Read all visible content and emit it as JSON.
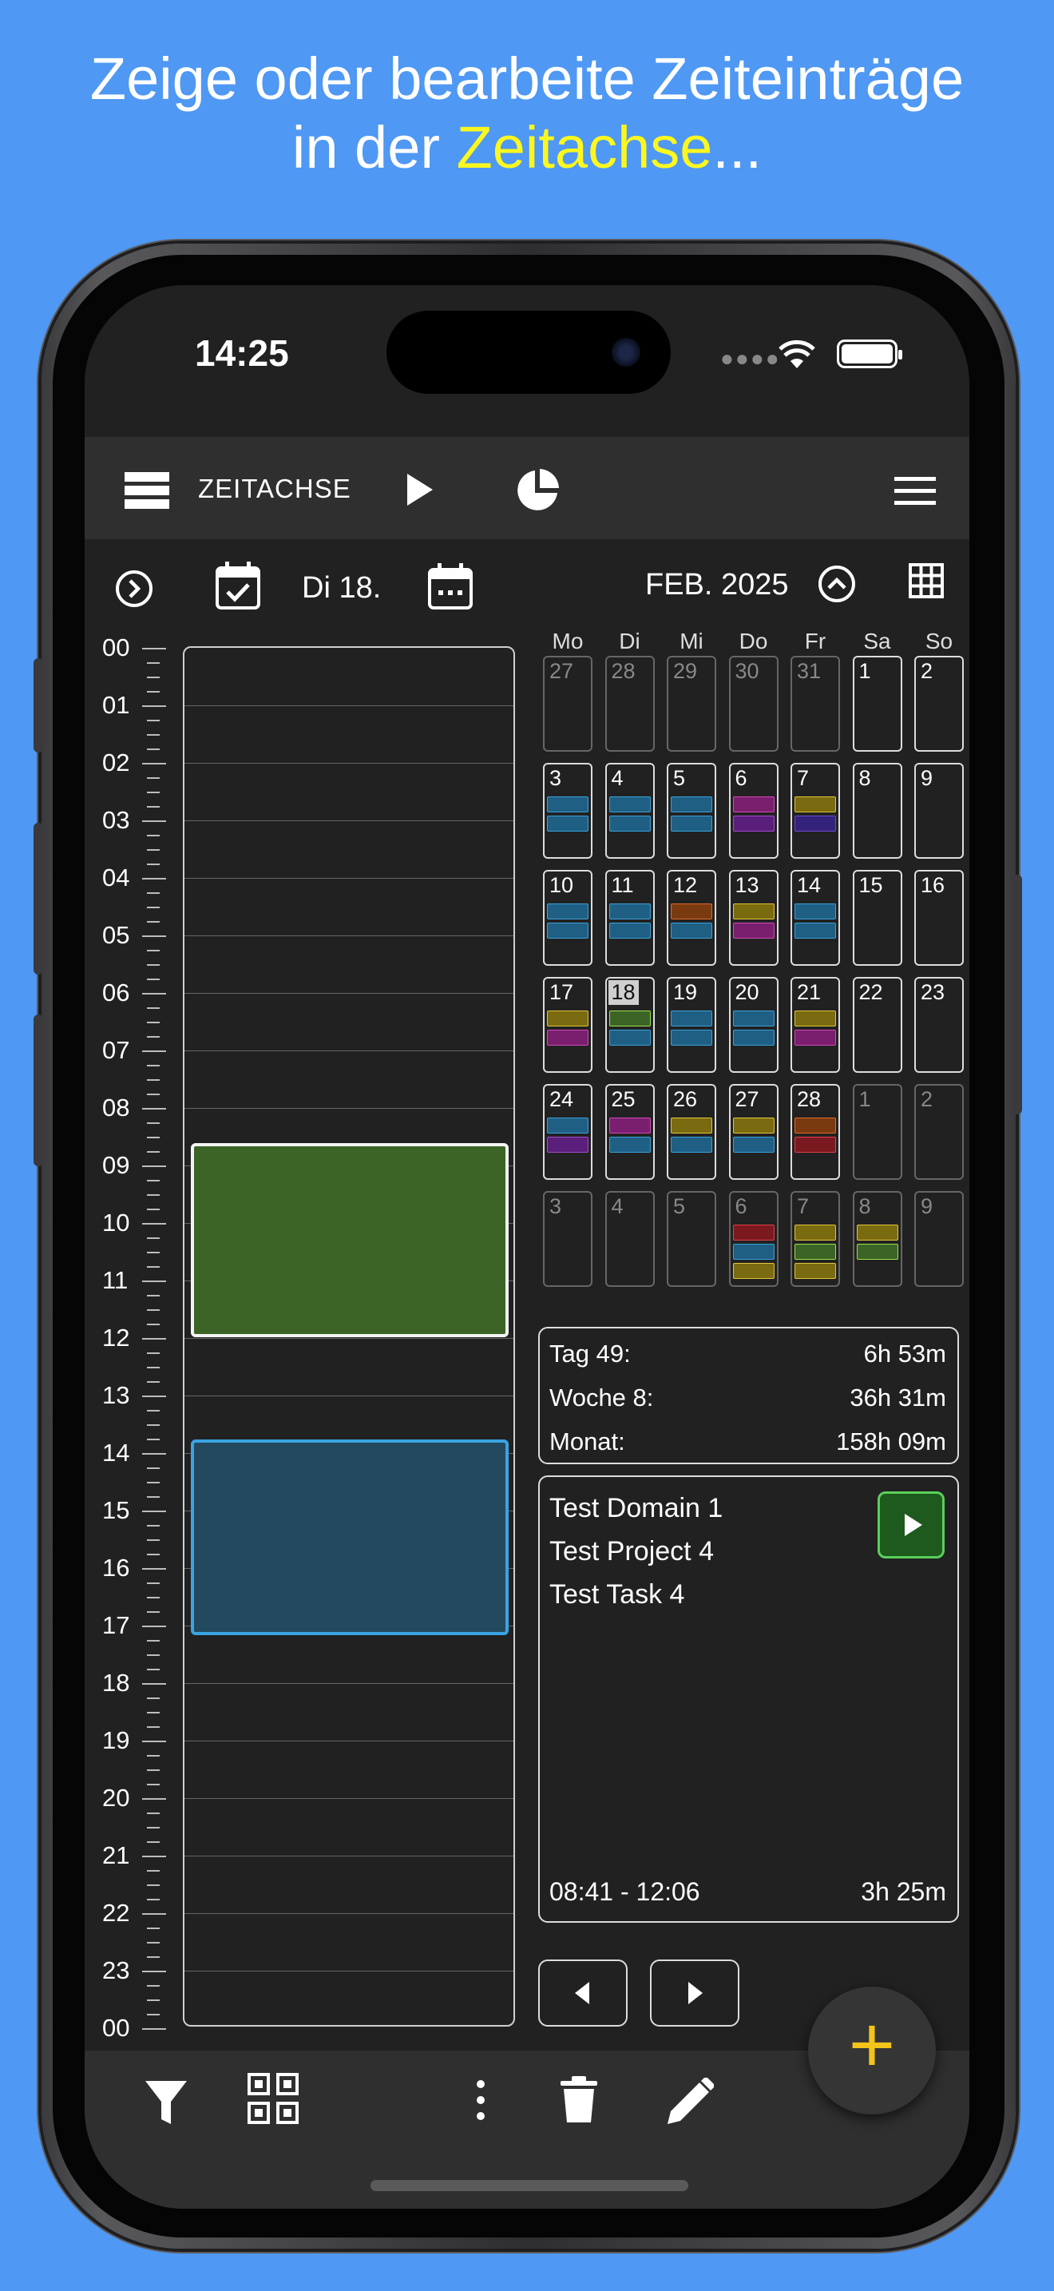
{
  "headline": {
    "line1": "Zeige oder bearbeite Zeiteinträge",
    "line2_prefix": "in der ",
    "line2_highlight": "Zeitachse",
    "line2_suffix": "..."
  },
  "status": {
    "time": "14:25"
  },
  "toolbar": {
    "title": "ZEITACHSE"
  },
  "daterow": {
    "day": "Di 18.",
    "month": "FEB. 2025"
  },
  "hours": [
    "00",
    "01",
    "02",
    "03",
    "04",
    "05",
    "06",
    "07",
    "08",
    "09",
    "10",
    "11",
    "12",
    "13",
    "14",
    "15",
    "16",
    "17",
    "18",
    "19",
    "20",
    "21",
    "22",
    "23",
    "00"
  ],
  "calendar": {
    "weekdays": [
      "Mo",
      "Di",
      "Mi",
      "Do",
      "Fr",
      "Sa",
      "So"
    ],
    "weeks": [
      [
        {
          "d": "27",
          "dim": true
        },
        {
          "d": "28",
          "dim": true
        },
        {
          "d": "29",
          "dim": true
        },
        {
          "d": "30",
          "dim": true
        },
        {
          "d": "31",
          "dim": true
        },
        {
          "d": "1"
        },
        {
          "d": "2"
        }
      ],
      [
        {
          "d": "3",
          "bars": [
            "blue",
            "blue"
          ]
        },
        {
          "d": "4",
          "bars": [
            "blue",
            "blue"
          ]
        },
        {
          "d": "5",
          "bars": [
            "blue",
            "blue"
          ]
        },
        {
          "d": "6",
          "bars": [
            "magenta",
            "purple"
          ]
        },
        {
          "d": "7",
          "bars": [
            "yellow",
            "indigo"
          ]
        },
        {
          "d": "8"
        },
        {
          "d": "9"
        }
      ],
      [
        {
          "d": "10",
          "bars": [
            "blue",
            "blue"
          ]
        },
        {
          "d": "11",
          "bars": [
            "blue",
            "blue"
          ]
        },
        {
          "d": "12",
          "bars": [
            "orange",
            "blue"
          ]
        },
        {
          "d": "13",
          "bars": [
            "yellow",
            "magenta"
          ]
        },
        {
          "d": "14",
          "bars": [
            "blue",
            "blue"
          ]
        },
        {
          "d": "15"
        },
        {
          "d": "16"
        }
      ],
      [
        {
          "d": "17",
          "bars": [
            "yellow",
            "magenta"
          ]
        },
        {
          "d": "18",
          "today": true,
          "bars": [
            "green",
            "blue"
          ]
        },
        {
          "d": "19",
          "bars": [
            "blue",
            "blue"
          ]
        },
        {
          "d": "20",
          "bars": [
            "blue",
            "blue"
          ]
        },
        {
          "d": "21",
          "bars": [
            "yellow",
            "magenta"
          ]
        },
        {
          "d": "22"
        },
        {
          "d": "23"
        }
      ],
      [
        {
          "d": "24",
          "bars": [
            "blue",
            "purple"
          ]
        },
        {
          "d": "25",
          "bars": [
            "magenta",
            "blue"
          ]
        },
        {
          "d": "26",
          "bars": [
            "yellow",
            "blue"
          ]
        },
        {
          "d": "27",
          "bars": [
            "yellow",
            "blue"
          ]
        },
        {
          "d": "28",
          "bars": [
            "orange",
            "red"
          ]
        },
        {
          "d": "1",
          "dim": true
        },
        {
          "d": "2",
          "dim": true
        }
      ],
      [
        {
          "d": "3",
          "dim": true
        },
        {
          "d": "4",
          "dim": true
        },
        {
          "d": "5",
          "dim": true
        },
        {
          "d": "6",
          "dim": true,
          "bars": [
            "red",
            "blue",
            "yellow"
          ]
        },
        {
          "d": "7",
          "dim": true,
          "bars": [
            "yellow",
            "green",
            "yellow"
          ]
        },
        {
          "d": "8",
          "dim": true,
          "bars": [
            "yellow",
            "green"
          ]
        },
        {
          "d": "9",
          "dim": true
        }
      ]
    ]
  },
  "colors": {
    "blue": [
      "#1f5f84",
      "#3aa0d8"
    ],
    "magenta": [
      "#7a1f6e",
      "#d04ab8"
    ],
    "purple": [
      "#5a1f7a",
      "#a44ad0"
    ],
    "yellow": [
      "#7a6a10",
      "#e0c63a"
    ],
    "indigo": [
      "#34237a",
      "#6b4ad0"
    ],
    "orange": [
      "#7a3a10",
      "#e06a2a"
    ],
    "green": [
      "#3b6426",
      "#a0e04a"
    ],
    "red": [
      "#7a1a20",
      "#e0404a"
    ]
  },
  "stats": [
    {
      "label": "Tag 49:",
      "value": "6h 53m"
    },
    {
      "label": "Woche 8:",
      "value": "36h 31m"
    },
    {
      "label": "Monat:",
      "value": "158h 09m"
    }
  ],
  "detail": {
    "domain": "Test Domain 1",
    "project": "Test Project 4",
    "task": "Test Task 4",
    "range": "08:41 - 12:06",
    "duration": "3h 25m"
  },
  "fab": {
    "label": "+"
  }
}
